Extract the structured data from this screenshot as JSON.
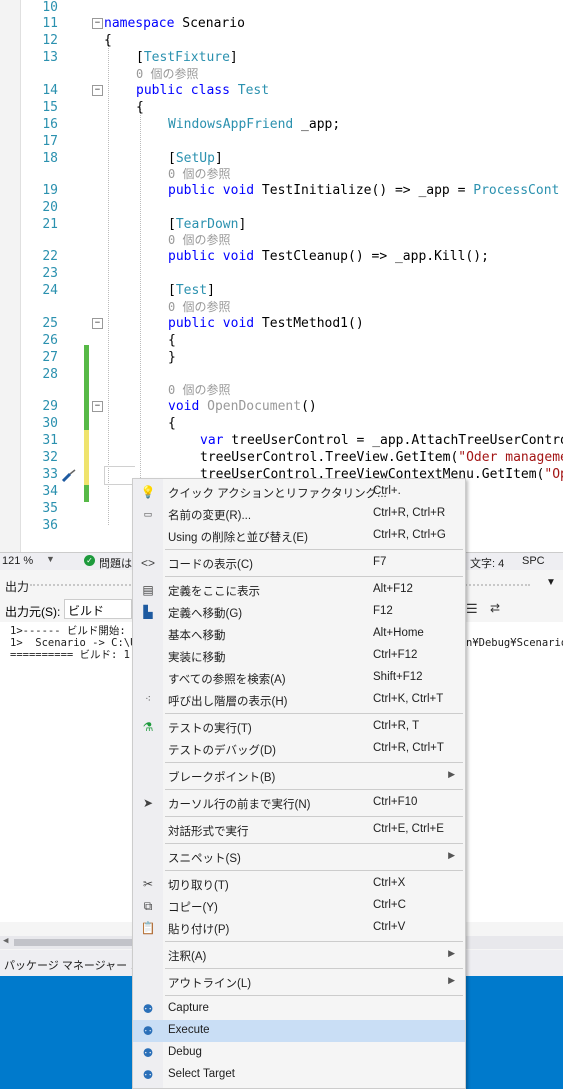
{
  "editor": {
    "lines": [
      {
        "n": "10",
        "t": ""
      },
      {
        "n": "11",
        "t": "namespace Scenario"
      },
      {
        "n": "12",
        "t": "{"
      },
      {
        "n": "13",
        "t": "    [TestFixture]",
        "ref": "0 個の参照"
      },
      {
        "n": "14",
        "t": "    public class Test"
      },
      {
        "n": "15",
        "t": "    {"
      },
      {
        "n": "16",
        "t": "        WindowsAppFriend _app;"
      },
      {
        "n": "17",
        "t": ""
      },
      {
        "n": "18",
        "t": "        [SetUp]",
        "ref": "0 個の参照"
      },
      {
        "n": "19",
        "t": "        public void TestInitialize() => _app = ProcessCont"
      },
      {
        "n": "20",
        "t": ""
      },
      {
        "n": "21",
        "t": "        [TearDown]",
        "ref": "0 個の参照"
      },
      {
        "n": "22",
        "t": "        public void TestCleanup() => _app.Kill();"
      },
      {
        "n": "23",
        "t": ""
      },
      {
        "n": "24",
        "t": "        [Test]",
        "ref": "0 個の参照"
      },
      {
        "n": "25",
        "t": "        public void TestMethod1()"
      },
      {
        "n": "26",
        "t": "        {"
      },
      {
        "n": "27",
        "t": "        }"
      },
      {
        "n": "28",
        "t": "",
        "ref": "0 個の参照"
      },
      {
        "n": "29",
        "t": "        void OpenDocument()"
      },
      {
        "n": "30",
        "t": "        {"
      },
      {
        "n": "31",
        "t": "            var treeUserControl = _app.AttachTreeUserContro"
      },
      {
        "n": "32",
        "t": "            treeUserControl.TreeView.GetItem(\"Oder manageme"
      },
      {
        "n": "33",
        "t": "            treeUserControl.TreeViewContextMenu.GetItem(\"Op"
      },
      {
        "n": "34",
        "t": ""
      },
      {
        "n": "35",
        "t": "        }"
      },
      {
        "n": "36",
        "t": "    }"
      }
    ]
  },
  "status": {
    "zoom": "121 %",
    "issues": "問題は",
    "chars": "文字: 4",
    "spc": "SPC"
  },
  "output": {
    "title": "出力",
    "source_label": "出力元(S):",
    "source_value": "ビルド",
    "lines": [
      "1>------ ビルド開始: ",
      "1>  Scenario -> C:\\U",
      "========== ビルド: 1"
    ],
    "right_fragment": "n¥Debug¥Scenario"
  },
  "tabs": {
    "package_manager": "パッケージ マネージャー コンソ"
  },
  "context_menu": {
    "items": [
      {
        "label": "クイック アクションとリファクタリング...",
        "shortcut": "Ctrl+.",
        "icon": "lightbulb-icon"
      },
      {
        "label": "名前の変更(R)...",
        "shortcut": "Ctrl+R, Ctrl+R",
        "icon": "rename-icon"
      },
      {
        "label": "Using の削除と並び替え(E)",
        "shortcut": "Ctrl+R, Ctrl+G",
        "icon": ""
      },
      {
        "label": "コードの表示(C)",
        "shortcut": "F7",
        "icon": "code-icon"
      },
      {
        "label": "定義をここに表示",
        "shortcut": "Alt+F12",
        "icon": "peek-definition-icon"
      },
      {
        "label": "定義へ移動(G)",
        "shortcut": "F12",
        "icon": "go-to-definition-icon"
      },
      {
        "label": "基本へ移動",
        "shortcut": "Alt+Home",
        "icon": ""
      },
      {
        "label": "実装に移動",
        "shortcut": "Ctrl+F12",
        "icon": ""
      },
      {
        "label": "すべての参照を検索(A)",
        "shortcut": "Shift+F12",
        "icon": ""
      },
      {
        "label": "呼び出し階層の表示(H)",
        "shortcut": "Ctrl+K, Ctrl+T",
        "icon": "call-hierarchy-icon"
      },
      {
        "label": "テストの実行(T)",
        "shortcut": "Ctrl+R, T",
        "icon": "run-test-icon"
      },
      {
        "label": "テストのデバッグ(D)",
        "shortcut": "Ctrl+R, Ctrl+T",
        "icon": ""
      },
      {
        "label": "ブレークポイント(B)",
        "shortcut": "",
        "icon": ""
      },
      {
        "label": "カーソル行の前まで実行(N)",
        "shortcut": "Ctrl+F10",
        "icon": "run-to-cursor-icon"
      },
      {
        "label": "対話形式で実行",
        "shortcut": "Ctrl+E, Ctrl+E",
        "icon": ""
      },
      {
        "label": "スニペット(S)",
        "shortcut": "",
        "icon": ""
      },
      {
        "label": "切り取り(T)",
        "shortcut": "Ctrl+X",
        "icon": "cut-icon"
      },
      {
        "label": "コピー(Y)",
        "shortcut": "Ctrl+C",
        "icon": "copy-icon"
      },
      {
        "label": "貼り付け(P)",
        "shortcut": "Ctrl+V",
        "icon": "paste-icon"
      },
      {
        "label": "注釈(A)",
        "shortcut": "",
        "icon": ""
      },
      {
        "label": "アウトライン(L)",
        "shortcut": "",
        "icon": ""
      },
      {
        "label": "Capture",
        "shortcut": "",
        "icon": "robot-icon"
      },
      {
        "label": "Execute",
        "shortcut": "",
        "icon": "robot-icon"
      },
      {
        "label": "Debug",
        "shortcut": "",
        "icon": "robot-icon"
      },
      {
        "label": "Select Target",
        "shortcut": "",
        "icon": "robot-icon"
      }
    ],
    "highlighted": "Execute"
  }
}
